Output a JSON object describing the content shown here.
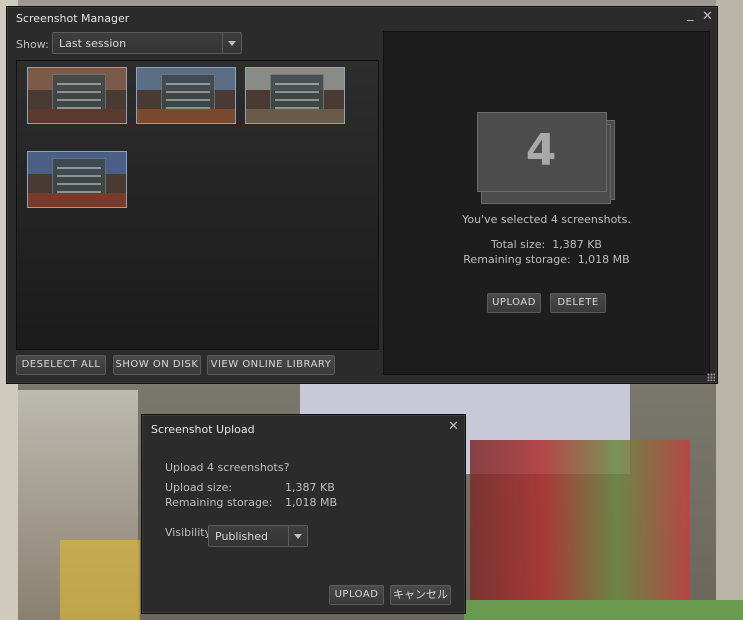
{
  "manager": {
    "title": "Screenshot Manager",
    "minimize_glyph": "_",
    "close_glyph": "✕",
    "show_label": "Show:",
    "show_selected": "Last session",
    "selected_count": "4",
    "selected_text": "You've selected 4 screenshots.",
    "total_size_label": "Total size:",
    "total_size_value": "1,387 KB",
    "remaining_label": "Remaining storage:",
    "remaining_value": "1,018 MB",
    "upload_button": "UPLOAD",
    "delete_button": "DELETE",
    "deselect_all_button": "DESELECT ALL",
    "show_on_disk_button": "SHOW ON DISK",
    "view_online_button": "VIEW ONLINE LIBRARY",
    "thumbnails": [
      {
        "sky": "#7b5a4a",
        "fg": "#5a3a2e"
      },
      {
        "sky": "#5c6e86",
        "fg": "#7a4a30"
      },
      {
        "sky": "#8a8a86",
        "fg": "#6a5a48"
      },
      {
        "sky": "#4a5e86",
        "fg": "#7a3a2a"
      }
    ]
  },
  "upload_dialog": {
    "title": "Screenshot Upload",
    "close_glyph": "✕",
    "question": "Upload 4 screenshots?",
    "upload_size_label": "Upload size:",
    "upload_size_value": "1,387 KB",
    "remaining_label": "Remaining storage:",
    "remaining_value": "1,018 MB",
    "visibility_label": "Visibility",
    "visibility_selected": "Published",
    "upload_button": "UPLOAD",
    "cancel_button": "キャンセル"
  },
  "colors": {
    "window_bg": "#2b2b2b",
    "panel_bg": "#1d1d1d",
    "thumb_border": "#8aa4c0"
  }
}
